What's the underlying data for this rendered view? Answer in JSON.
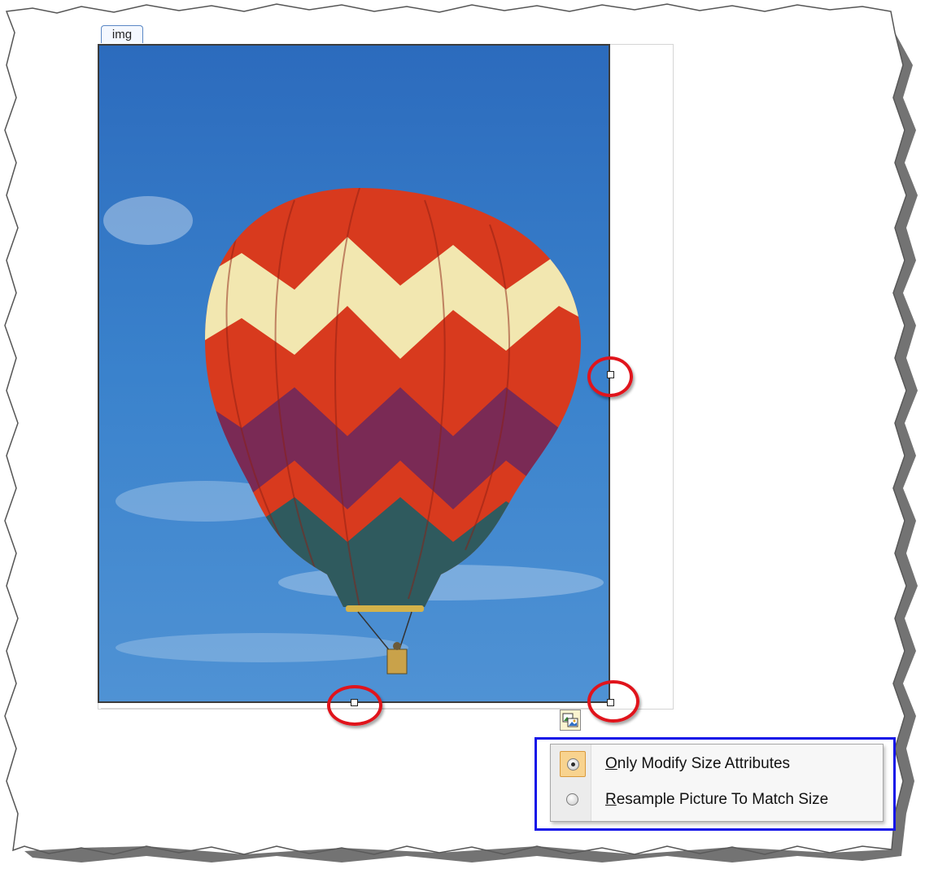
{
  "element_tag": {
    "label": "img"
  },
  "image": {
    "description_icon": "hot-air-balloon-photo"
  },
  "smart_tag": {
    "icon": "picture-options-icon"
  },
  "resize_options": {
    "items": [
      {
        "access_key": "O",
        "rest": "nly Modify Size Attributes",
        "checked": true
      },
      {
        "access_key": "R",
        "rest": "esample Picture To Match Size",
        "checked": false
      }
    ]
  },
  "colors": {
    "highlight_ring": "#e0141c",
    "callout_border": "#1414e8",
    "checked_item_bg": "#f8d38f"
  }
}
